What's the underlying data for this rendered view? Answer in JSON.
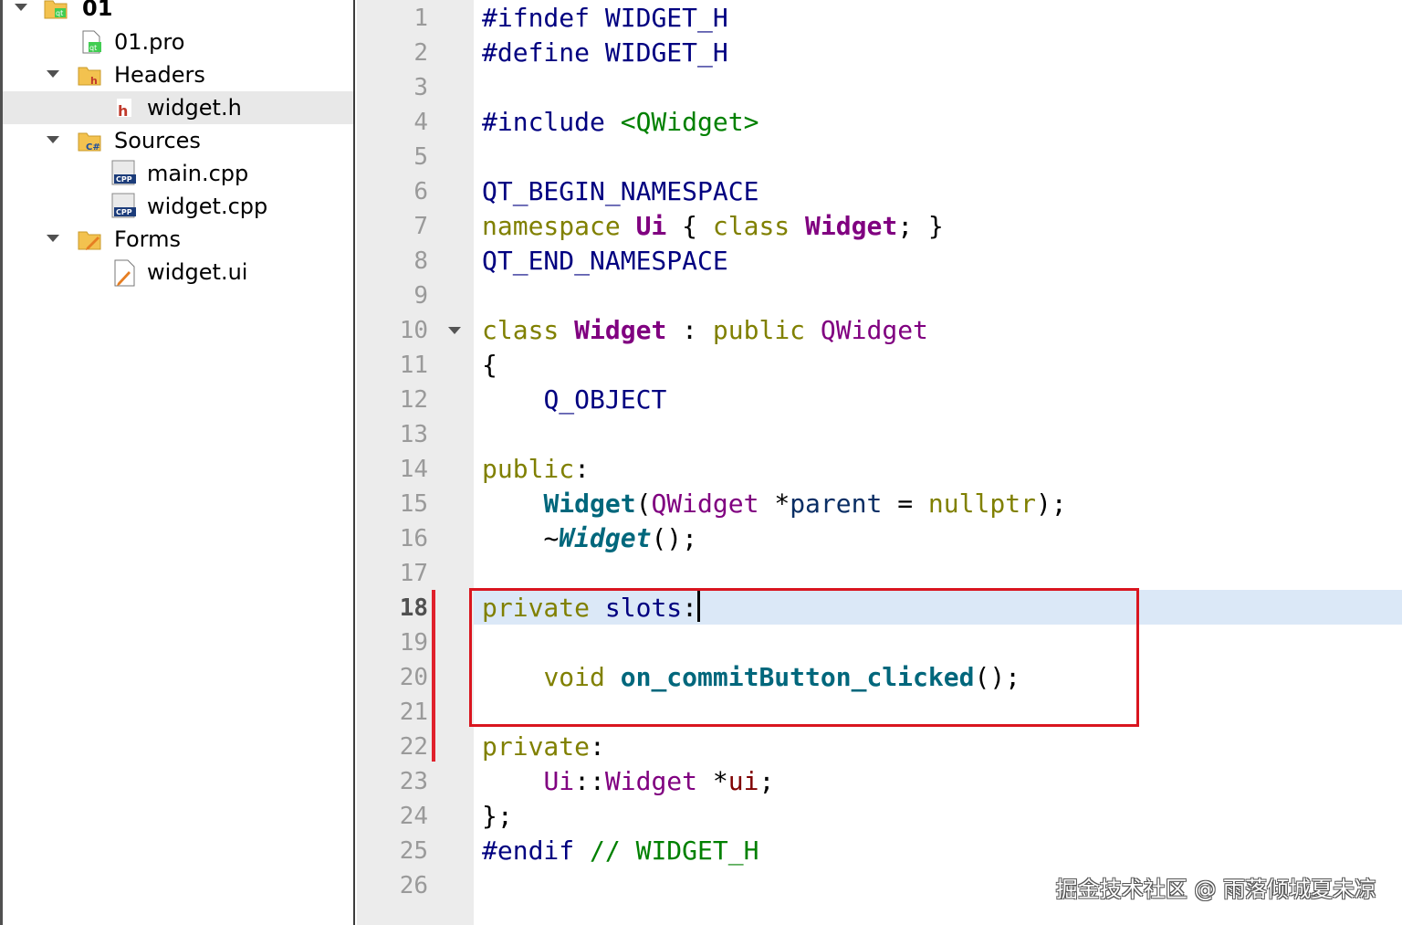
{
  "project_tree": {
    "root": "01",
    "pro_file": "01.pro",
    "headers_label": "Headers",
    "header_file": "widget.h",
    "sources_label": "Sources",
    "source_main": "main.cpp",
    "source_widget": "widget.cpp",
    "forms_label": "Forms",
    "form_file": "widget.ui",
    "selected": "widget.h"
  },
  "editor": {
    "current_line": 18,
    "line_numbers": [
      "1",
      "2",
      "3",
      "4",
      "5",
      "6",
      "7",
      "8",
      "9",
      "10",
      "11",
      "12",
      "13",
      "14",
      "15",
      "16",
      "17",
      "18",
      "19",
      "20",
      "21",
      "22",
      "23",
      "24",
      "25",
      "26"
    ],
    "code": {
      "l1_directive": "#ifndef",
      "l1_macro": "WIDGET_H",
      "l2_directive": "#define",
      "l2_macro": "WIDGET_H",
      "l4_directive": "#include",
      "l4_header": "<QWidget>",
      "l6_macro": "QT_BEGIN_NAMESPACE",
      "l7_kw": "namespace",
      "l7_ns": "Ui",
      "l7_open": "{",
      "l7_kw2": "class",
      "l7_class": "Widget",
      "l7_close": "; }",
      "l8_macro": "QT_END_NAMESPACE",
      "l10_kw": "class",
      "l10_class": "Widget",
      "l10_colon": ":",
      "l10_kw2": "public",
      "l10_base": "QWidget",
      "l11": "{",
      "l12": "Q_OBJECT",
      "l14_kw": "public",
      "l14_colon": ":",
      "l15_fn": "Widget",
      "l15_paren": "(",
      "l15_type": "QWidget",
      "l15_ptr": " *",
      "l15_param": "parent",
      "l15_eq": " = ",
      "l15_null": "nullptr",
      "l15_end": ");",
      "l16_tilde": "~",
      "l16_fn": "Widget",
      "l16_end": "();",
      "l18_kw": "private",
      "l18_slots": "slots",
      "l18_colon": ":",
      "l20_kw": "void",
      "l20_fn": "on_commitButton_clicked",
      "l20_end": "();",
      "l22_kw": "private",
      "l22_colon": ":",
      "l23_ns": "Ui",
      "l23_sep": "::",
      "l23_type": "Widget",
      "l23_ptr": " *",
      "l23_member": "ui",
      "l23_end": ";",
      "l24": "};",
      "l25_directive": "#endif",
      "l25_comment": "// WIDGET_H"
    }
  },
  "watermark": "掘金技术社区 @ 雨落倾城夏未凉",
  "colors": {
    "preprocessor": "#000080",
    "keyword": "#808000",
    "type": "#800080",
    "function": "#00677c",
    "string": "#008000",
    "highlight_box": "#d9151f",
    "current_line_bg": "#dbe8f7"
  }
}
